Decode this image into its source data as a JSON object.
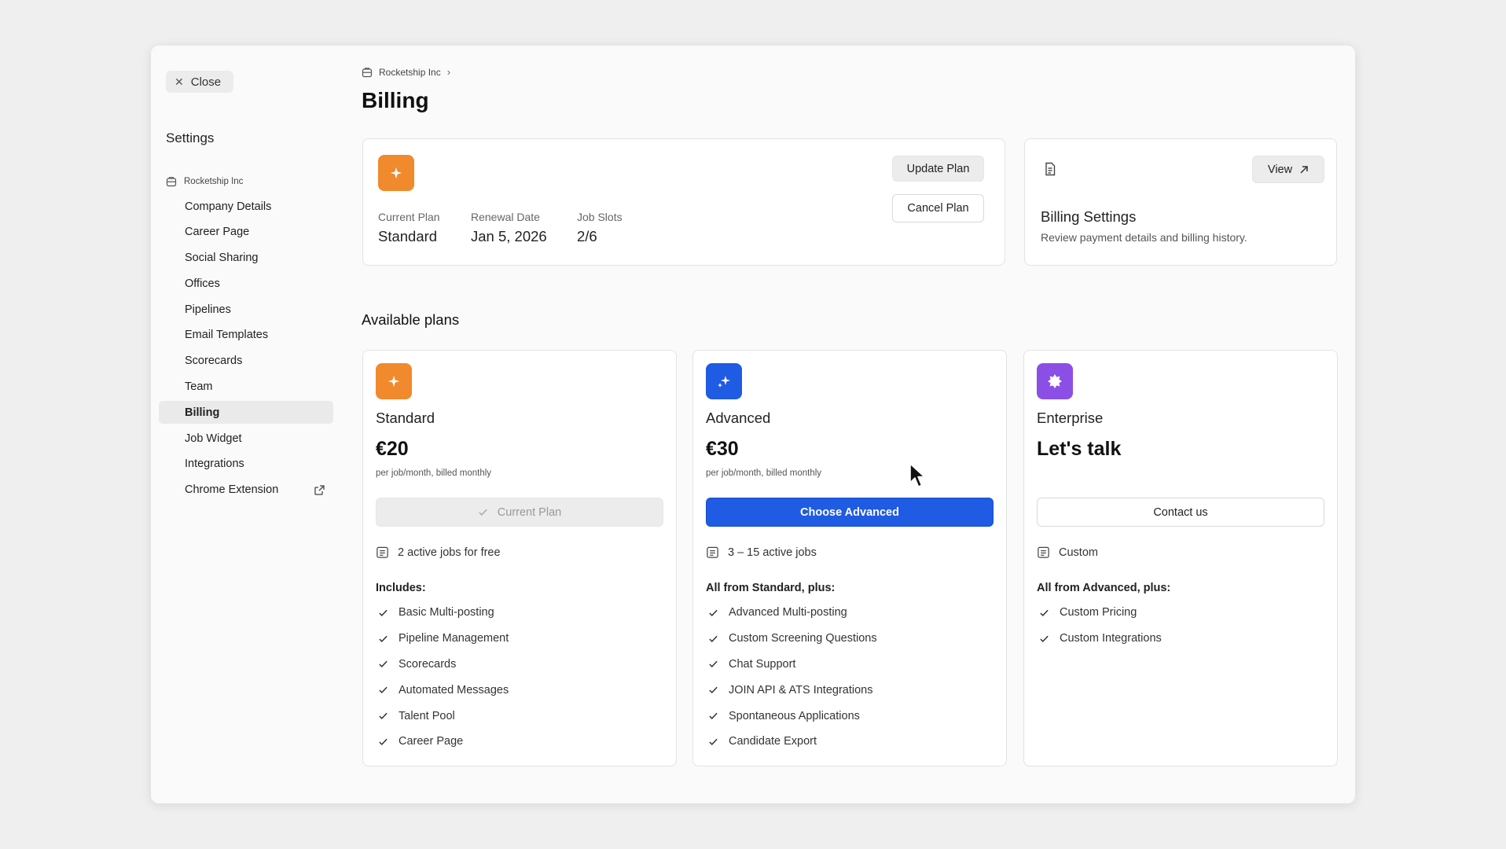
{
  "sidebar": {
    "close_label": "Close",
    "title": "Settings",
    "org_name": "Rocketship Inc",
    "items": [
      {
        "label": "Company Details"
      },
      {
        "label": "Career Page"
      },
      {
        "label": "Social Sharing"
      },
      {
        "label": "Offices"
      },
      {
        "label": "Pipelines"
      },
      {
        "label": "Email Templates"
      },
      {
        "label": "Scorecards"
      },
      {
        "label": "Team"
      },
      {
        "label": "Billing",
        "active": true
      },
      {
        "label": "Job Widget"
      },
      {
        "label": "Integrations"
      },
      {
        "label": "Chrome Extension",
        "external": true
      }
    ]
  },
  "breadcrumb": {
    "org": "Rocketship Inc"
  },
  "page_title": "Billing",
  "current_plan_card": {
    "update_label": "Update Plan",
    "cancel_label": "Cancel Plan",
    "current_plan_label": "Current Plan",
    "current_plan_value": "Standard",
    "renewal_label": "Renewal Date",
    "renewal_value": "Jan 5, 2026",
    "slots_label": "Job Slots",
    "slots_value": "2/6"
  },
  "billing_settings_card": {
    "view_label": "View",
    "title": "Billing Settings",
    "description": "Review payment details and billing history."
  },
  "available_plans_title": "Available plans",
  "plans": [
    {
      "name": "Standard",
      "price": "€20",
      "price_note": "per job/month, billed monthly",
      "button_label": "Current Plan",
      "jobs": "2 active jobs for free",
      "includes_title": "Includes:",
      "features": [
        "Basic Multi-posting",
        "Pipeline Management",
        "Scorecards",
        "Automated Messages",
        "Talent Pool",
        "Career Page"
      ]
    },
    {
      "name": "Advanced",
      "price": "€30",
      "price_note": "per job/month, billed monthly",
      "button_label": "Choose Advanced",
      "jobs": "3 – 15 active jobs",
      "includes_title": "All from Standard, plus:",
      "features": [
        "Advanced Multi-posting",
        "Custom Screening Questions",
        "Chat Support",
        "JOIN API & ATS Integrations",
        "Spontaneous Applications",
        "Candidate Export"
      ]
    },
    {
      "name": "Enterprise",
      "price": "Let's talk",
      "price_note": "",
      "button_label": "Contact us",
      "jobs": "Custom",
      "includes_title": "All from Advanced, plus:",
      "features": [
        "Custom Pricing",
        "Custom Integrations"
      ]
    }
  ],
  "colors": {
    "standard_accent": "#f08a2c",
    "advanced_accent": "#1f5be3",
    "enterprise_accent": "#8b4fe6",
    "primary_button": "#1f5be3"
  }
}
